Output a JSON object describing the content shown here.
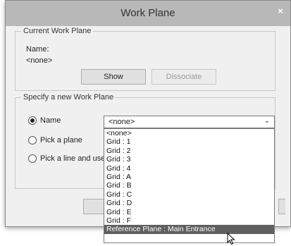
{
  "window": {
    "title": "Work Plane",
    "close_symbol": "×"
  },
  "current_work_plane": {
    "legend": "Current Work Plane",
    "name_label": "Name:",
    "name_value": "<none>",
    "show_button": "Show",
    "dissociate_button": "Dissociate"
  },
  "specify": {
    "legend": "Specify a new Work Plane",
    "options": [
      {
        "label": "Name",
        "checked": true
      },
      {
        "label": "Pick a plane",
        "checked": false
      },
      {
        "label": "Pick a line and use",
        "checked": false
      }
    ],
    "combo_value": "<none>",
    "combo_arrow": "⌄"
  },
  "dropdown": {
    "items": [
      "<none>",
      "Grid : 1",
      "Grid : 2",
      "Grid : 3",
      "Grid : 4",
      "Grid : A",
      "Grid : B",
      "Grid : C",
      "Grid : D",
      "Grid : E",
      "Grid : F",
      "Reference Plane : Main Entrance"
    ],
    "selected_index": 11
  },
  "icons": {
    "cursor": "mouse-pointer-icon"
  }
}
